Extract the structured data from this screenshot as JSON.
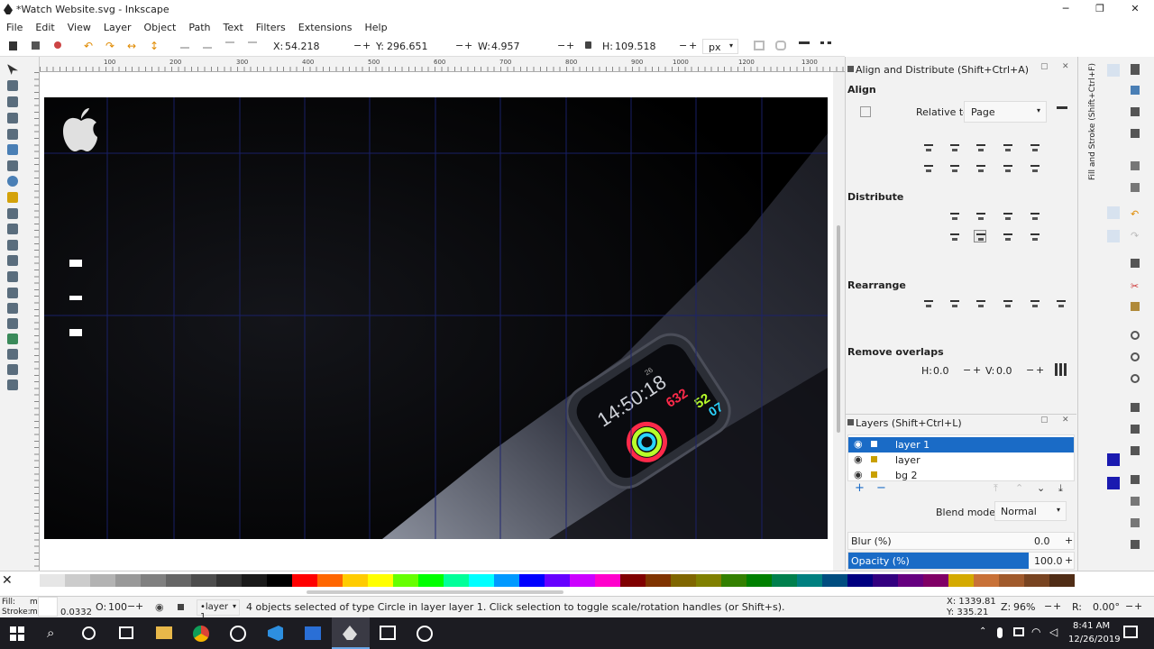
{
  "window": {
    "title": "*Watch Website.svg - Inkscape",
    "min": "─",
    "max": "❐",
    "close": "✕"
  },
  "menu": [
    "File",
    "Edit",
    "View",
    "Layer",
    "Object",
    "Path",
    "Text",
    "Filters",
    "Extensions",
    "Help"
  ],
  "toolctl": {
    "x_label": "X:",
    "x": "54.218",
    "y_label": "Y:",
    "y": "296.651",
    "w_label": "W:",
    "w": "4.957",
    "h_label": "H:",
    "h": "109.518",
    "unit": "px",
    "minus": "−",
    "plus": "+"
  },
  "ruler": [
    "100",
    "200",
    "300",
    "400",
    "500",
    "600",
    "700",
    "800",
    "900",
    "1000",
    "1100",
    "1200",
    "1300"
  ],
  "watch": {
    "time": "14:50:18",
    "n1": "632",
    "n2": "52",
    "n3": "07",
    "n4": "26"
  },
  "dock": {
    "title": "Align and Distribute (Shift+Ctrl+A)",
    "align": "Align",
    "relative_label": "Relative to:",
    "relative_value": "Page",
    "distribute": "Distribute",
    "rearrange": "Rearrange",
    "remove_overlaps": "Remove overlaps",
    "h_label": "H:",
    "h_value": "0.0",
    "v_label": "V:",
    "v_value": "0.0",
    "layers_title": "Layers (Shift+Ctrl+L)",
    "layers": [
      "layer 1",
      "layer",
      "bg 2"
    ],
    "blend_label": "Blend mode:",
    "blend_value": "Normal",
    "blur_label": "Blur (%)",
    "blur_value": "0.0",
    "opacity_label": "Opacity (%)",
    "opacity_value": "100.0",
    "side_tab": "Fill and Stroke (Shift+Ctrl+F)"
  },
  "status": {
    "fill_label": "Fill:",
    "fill_value": "m",
    "stroke_label": "Stroke:",
    "stroke_value": "m",
    "stroke_width": "0.0332",
    "o_label": "O:",
    "opacity": "100",
    "layer": "•layer 1",
    "message": "4 objects selected of type Circle in layer layer 1. Click selection to toggle scale/rotation handles (or Shift+s).",
    "x_coord": "X: 1339.81",
    "y_coord": "Y:   335.21",
    "z_label": "Z:",
    "zoom": "96%",
    "r_label": "R:",
    "rotation": "0.00°"
  },
  "taskbar": {
    "time": "8:41 AM",
    "date": "12/26/2019"
  },
  "palette": [
    "#ffffff",
    "#e6e6e6",
    "#cccccc",
    "#b3b3b3",
    "#999999",
    "#808080",
    "#666666",
    "#4d4d4d",
    "#333333",
    "#1a1a1a",
    "#000000",
    "#ff0000",
    "#ff6600",
    "#ffcc00",
    "#ffff00",
    "#66ff00",
    "#00ff00",
    "#00ff99",
    "#00ffff",
    "#0099ff",
    "#0000ff",
    "#6600ff",
    "#cc00ff",
    "#ff00cc",
    "#800000",
    "#803300",
    "#806600",
    "#808000",
    "#338000",
    "#008000",
    "#00804d",
    "#008080",
    "#004d80",
    "#000080",
    "#330080",
    "#660080",
    "#800066",
    "#d4aa00",
    "#c87137",
    "#a05a2c",
    "#784421",
    "#502d16"
  ],
  "colors": {
    "accent": "#1a6bc6",
    "canvas": "#000000"
  }
}
